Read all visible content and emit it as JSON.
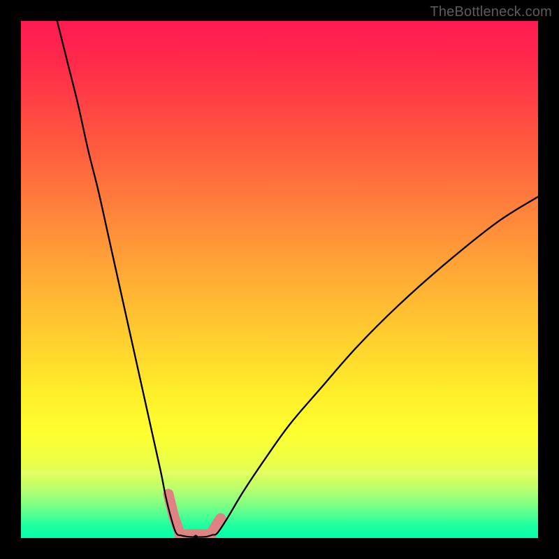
{
  "watermark": "TheBottleneck.com",
  "colors": {
    "frame": "#000000",
    "curve": "#000000",
    "marker_fill": "#de8282",
    "marker_stroke": "#c96f6f",
    "gradient_top": "#ff1a52",
    "gradient_bottom": "#00ffaa"
  },
  "chart_data": {
    "type": "line",
    "title": "",
    "xlabel": "",
    "ylabel": "",
    "xlim": [
      0,
      100
    ],
    "ylim": [
      0,
      100
    ],
    "note": "V-shaped bottleneck curve. x is a configuration parameter (0–100), y is bottleneck percentage (0 = optimal/green, 100 = severe/red). Values estimated from pixels. Two branches drop from both sides to a near-zero flat trough around x≈30–38.",
    "series": [
      {
        "name": "left-branch",
        "x": [
          7,
          9,
          11,
          13,
          15,
          17,
          19,
          21,
          23,
          25,
          27,
          28,
          29,
          30
        ],
        "y": [
          100,
          92,
          84,
          75,
          67,
          58,
          49,
          40,
          31,
          22,
          13,
          8,
          4,
          1
        ]
      },
      {
        "name": "trough",
        "x": [
          30,
          31,
          32,
          33,
          34,
          35,
          36,
          37,
          38
        ],
        "y": [
          1,
          0.5,
          0.3,
          0.2,
          0.2,
          0.2,
          0.3,
          0.6,
          1
        ]
      },
      {
        "name": "right-branch",
        "x": [
          38,
          40,
          43,
          47,
          52,
          58,
          65,
          73,
          82,
          92,
          100
        ],
        "y": [
          1,
          4,
          9,
          15,
          22,
          29,
          37,
          45,
          53,
          61,
          66
        ]
      }
    ],
    "markers": {
      "name": "highlighted-points",
      "note": "Short fat pink segments (sausage markers) near the trough, plus a tiny marker at the curve minimum.",
      "segments": [
        {
          "x": [
            28.5,
            29.6
          ],
          "y": [
            8.5,
            4.0
          ]
        },
        {
          "x": [
            29.8,
            30.6
          ],
          "y": [
            3.5,
            1.2
          ]
        },
        {
          "x": [
            36.8,
            37.6
          ],
          "y": [
            1.0,
            2.2
          ]
        },
        {
          "x": [
            37.8,
            38.6
          ],
          "y": [
            2.6,
            3.8
          ]
        }
      ],
      "trough_blob": {
        "x": [
          31.0,
          36.5
        ],
        "y": [
          0.4,
          0.4
        ]
      },
      "min_point": {
        "x": 33.8,
        "y": 0.2
      }
    }
  }
}
